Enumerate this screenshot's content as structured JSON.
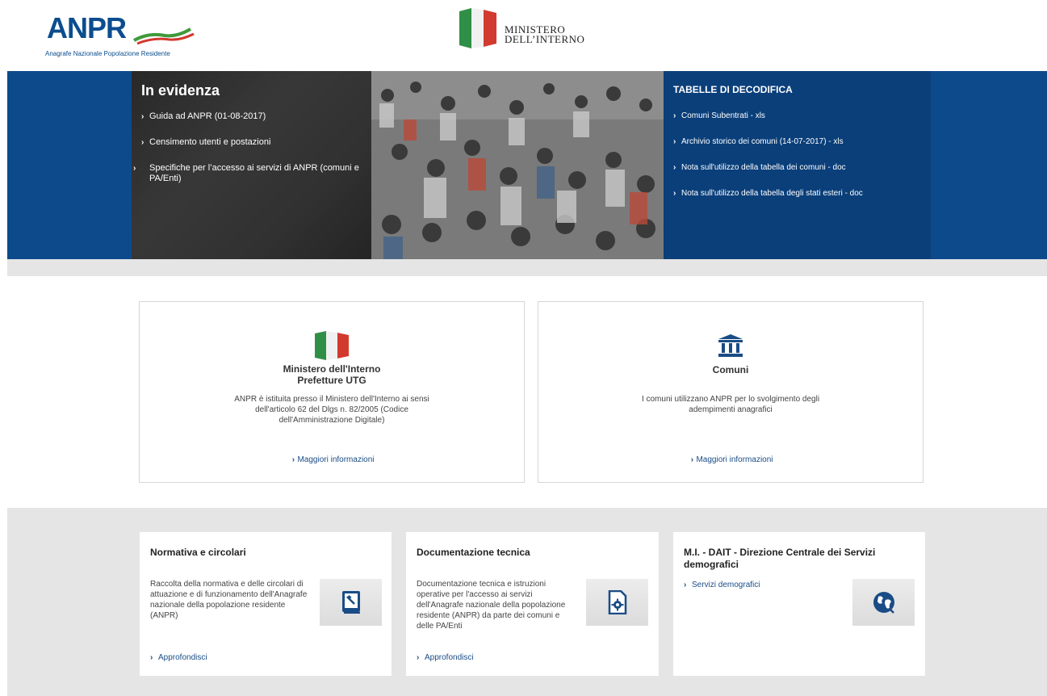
{
  "header": {
    "logo_text": "ANPR",
    "logo_subtitle": "Anagrafe Nazionale Popolazione Residente",
    "ministry_line1": "MINISTERO",
    "ministry_line2": "DELL’INTERNO"
  },
  "banner": {
    "evidenza_title": "In evidenza",
    "evidenza_items": [
      "Guida ad ANPR (01-08-2017)",
      "Censimento utenti e postazioni",
      "Specifiche per l’accesso ai servizi di ANPR (comuni e PA/Enti)"
    ],
    "tabelle_title": "TABELLE DI DECODIFICA",
    "tabelle_items": [
      "Comuni Subentrati - xls",
      "Archivio storico dei comuni (14-07-2017) - xls",
      "Nota sull'utilizzo della tabella dei comuni - doc",
      "Nota sull'utilizzo della tabella degli stati esteri - doc"
    ]
  },
  "mid_cards": {
    "ministero": {
      "title_line1": "Ministero dell'Interno",
      "title_line2": "Prefetture UTG",
      "desc": "ANPR è istituita presso il Ministero dell'Interno ai sensi dell'articolo 62 del Dlgs n. 82/2005 (Codice dell'Amministrazione Digitale)",
      "link": "Maggiori informazioni"
    },
    "comuni": {
      "title": "Comuni",
      "desc": "I comuni utilizzano ANPR per lo svolgimento degli adempimenti anagrafici",
      "link": "Maggiori informazioni"
    }
  },
  "bottom_cards": {
    "normativa": {
      "title": "Normativa e circolari",
      "desc": "Raccolta della normativa e delle circolari di attuazione e di funzionamento dell'Anagrafe nazionale della popolazione residente (ANPR)",
      "link": "Approfondisci"
    },
    "documentazione": {
      "title": "Documentazione tecnica",
      "desc": "Documentazione tecnica e istruzioni operative per l'accesso ai servizi dell'Anagrafe nazionale della popolazione residente (ANPR) da parte dei comuni e delle PA/Enti",
      "link": "Approfondisci"
    },
    "dait": {
      "title": "M.I. - DAIT - Direzione Centrale dei Servizi demografici",
      "link": "Servizi demografici"
    }
  },
  "colors": {
    "brand_blue": "#0d4a8b",
    "link_blue": "#1a4c86",
    "flag_green": "#2f8f46",
    "flag_red": "#d23a2f"
  }
}
